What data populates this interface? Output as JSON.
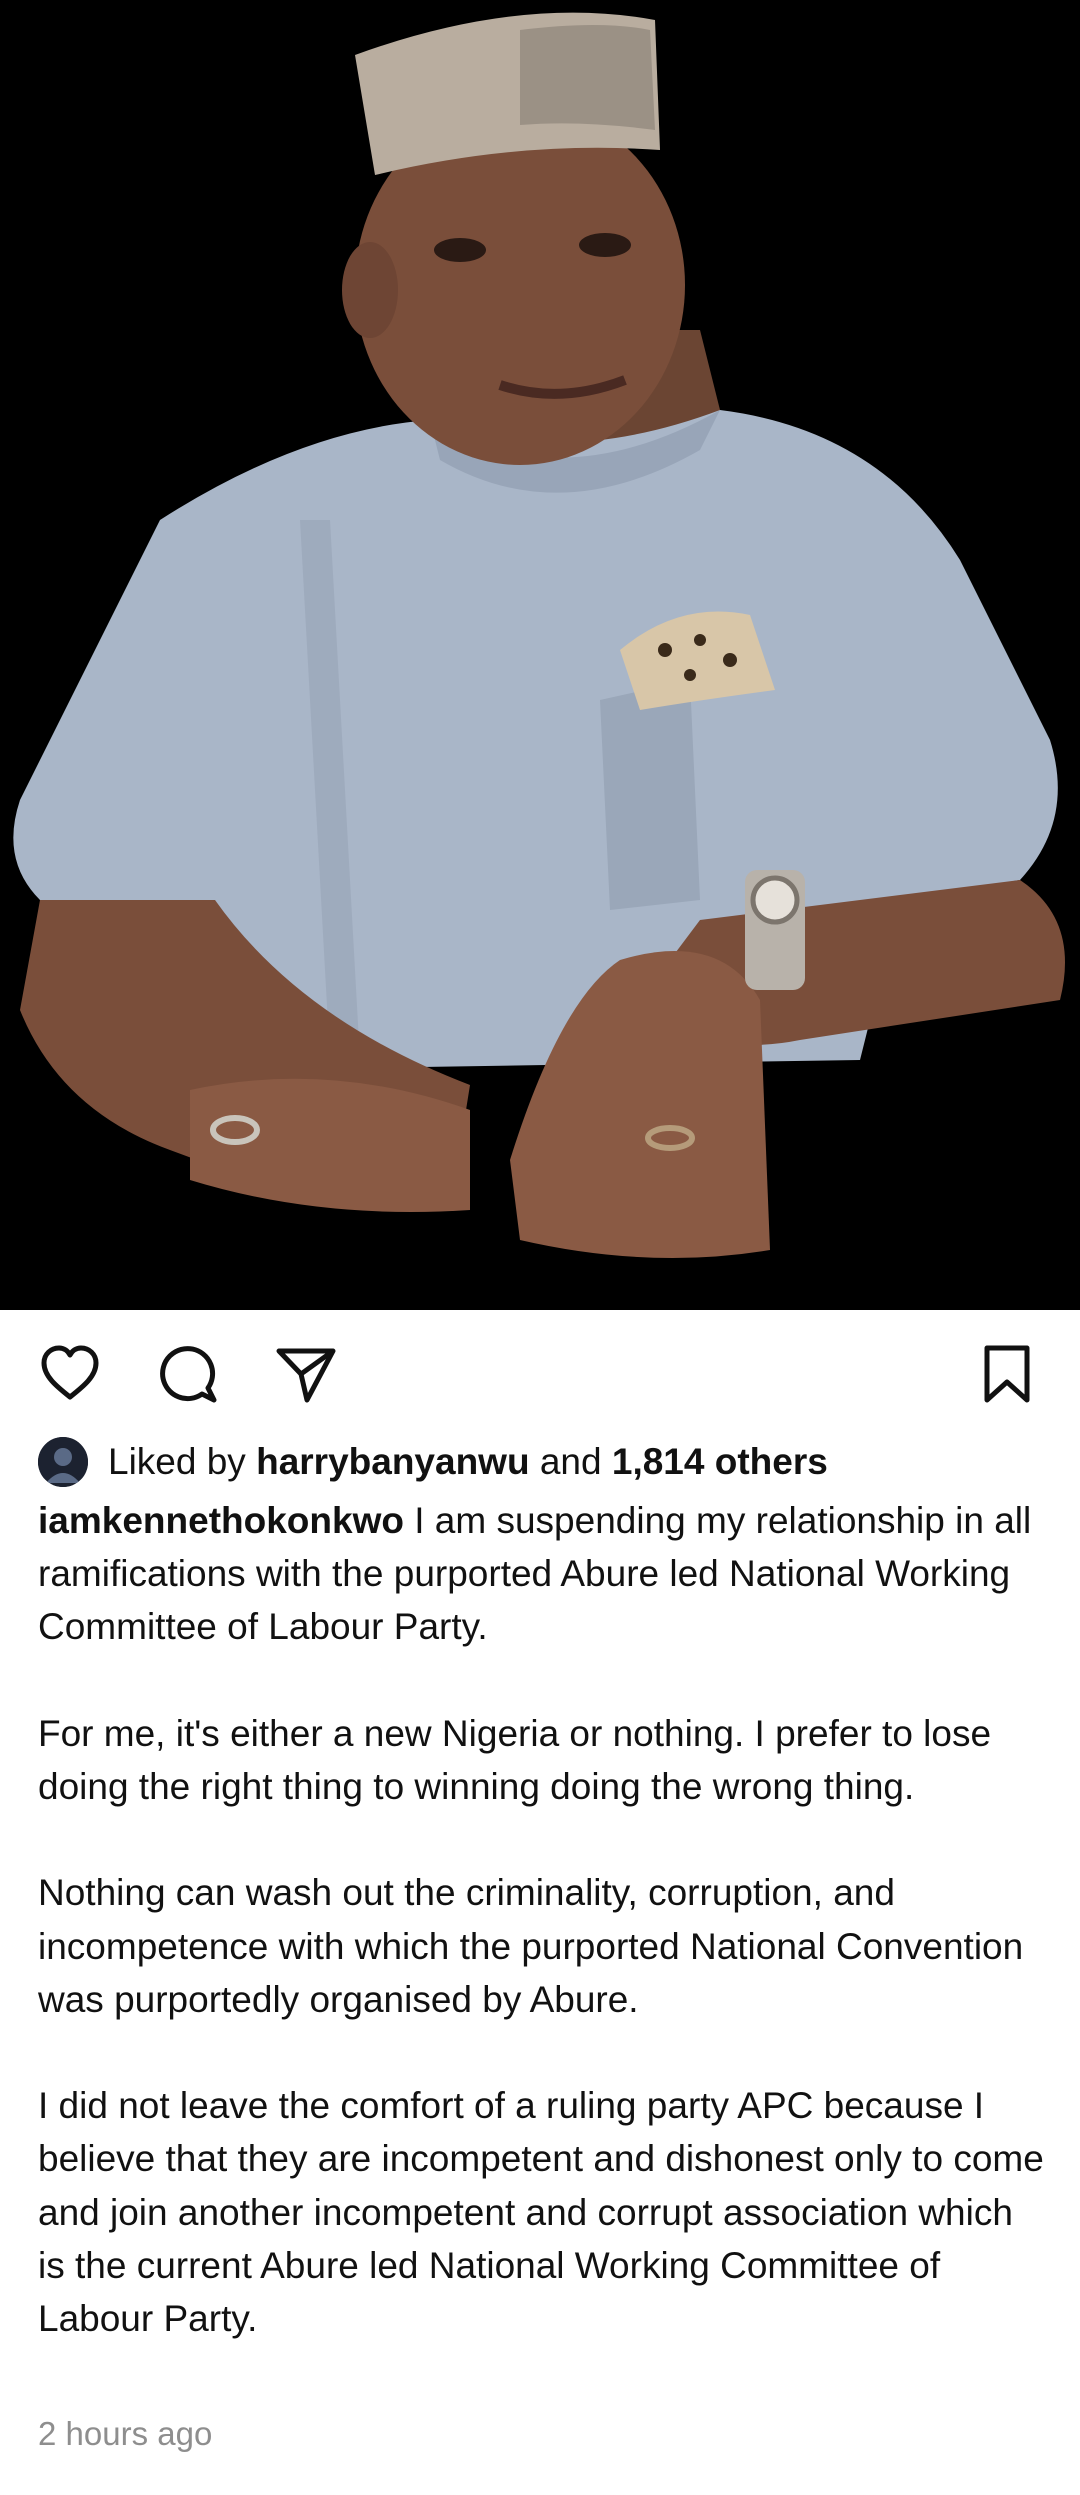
{
  "post": {
    "photo_subject": "man-in-grey-kaftan-and-cap",
    "icons": {
      "like": "heart-icon",
      "comment": "comment-icon",
      "share": "share-icon",
      "save": "bookmark-icon"
    },
    "likes": {
      "prefix": "Liked by",
      "user": "harrybanyanwu",
      "conjunction": "and",
      "others": "1,814 others"
    },
    "caption": {
      "username": "iamkennethokonkwo",
      "paragraphs": [
        "I am suspending my relationship in all ramifications with the purported Abure led National Working Committee of Labour Party.",
        "For me, it's either a new Nigeria or nothing. I prefer to lose doing the right thing to winning doing the wrong thing.",
        "Nothing can wash out the criminality, corruption, and incompetence with which the purported National Convention was purportedly organised by Abure.",
        "I did not leave the comfort of a ruling party APC because I believe that they are incompetent and dishonest only to come and join another incompetent and corrupt association which is the current Abure led National Working Committee of Labour Party."
      ]
    },
    "timestamp": "2 hours ago"
  },
  "colors": {
    "photo_background": "#000000",
    "text": "#111111",
    "muted": "#8e8e8e",
    "kaftan": "#a9b6c8"
  }
}
